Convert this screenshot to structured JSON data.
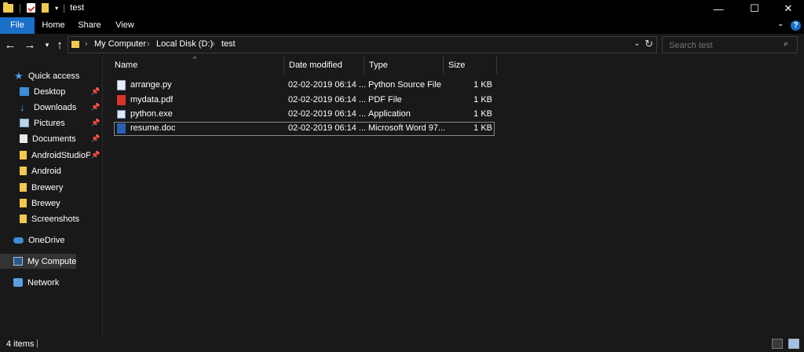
{
  "window": {
    "title": "test",
    "minimize": "—",
    "maximize": "☐",
    "close": "✕"
  },
  "ribbon": {
    "tabs": [
      {
        "label": "File"
      },
      {
        "label": "Home"
      },
      {
        "label": "Share"
      },
      {
        "label": "View"
      }
    ]
  },
  "address": {
    "breadcrumbs": [
      "My Computer",
      "Local Disk (D:)",
      "test"
    ],
    "search_placeholder": "Search test"
  },
  "sidebar": {
    "quick_access": "Quick access",
    "items": [
      {
        "label": "Desktop"
      },
      {
        "label": "Downloads"
      },
      {
        "label": "Pictures"
      },
      {
        "label": "Documents"
      },
      {
        "label": "AndroidStudioPr"
      },
      {
        "label": "Android"
      },
      {
        "label": "Brewery"
      },
      {
        "label": "Brewey"
      },
      {
        "label": "Screenshots"
      }
    ],
    "onedrive": "OneDrive",
    "my_computer": "My Computer",
    "network": "Network"
  },
  "columns": {
    "name": "Name",
    "date": "Date modified",
    "type": "Type",
    "size": "Size"
  },
  "files": [
    {
      "name": "arrange.py",
      "date": "02-02-2019 06:14 ...",
      "type": "Python Source File",
      "size": "1 KB"
    },
    {
      "name": "mydata.pdf",
      "date": "02-02-2019 06:14 ...",
      "type": "PDF File",
      "size": "1 KB"
    },
    {
      "name": "python.exe",
      "date": "02-02-2019 06:14 ...",
      "type": "Application",
      "size": "1 KB"
    },
    {
      "name": "resume.doc",
      "date": "02-02-2019 06:14 ...",
      "type": "Microsoft Word 97...",
      "size": "1 KB"
    }
  ],
  "status": {
    "item_count": "4 items"
  },
  "colors": {
    "accent": "#1a6fc9",
    "folder": "#f2c94c",
    "background": "#191919"
  }
}
